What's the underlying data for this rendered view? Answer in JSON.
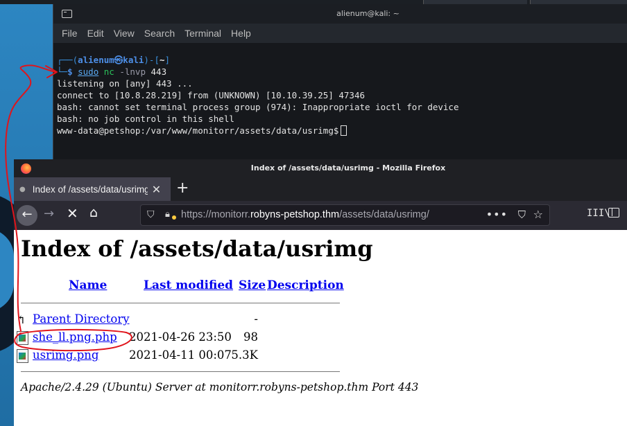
{
  "terminal": {
    "title": "alienum@kali: ~",
    "menu": [
      "File",
      "Edit",
      "View",
      "Search",
      "Terminal",
      "Help"
    ],
    "prompt": {
      "open": "┌──(",
      "user_host": "alienum㉿kali",
      "dir_open": ")-[",
      "dir": "~",
      "dir_close": "]",
      "prefix": "└─",
      "dollar": "$",
      "cmd": "sudo",
      "prog": "nc",
      "args": "-lnvp",
      "port": "443"
    },
    "output": [
      "listening on [any] 443 ...",
      "connect to [10.8.28.219] from (UNKNOWN) [10.10.39.25] 47346",
      "bash: cannot set terminal process group (974): Inappropriate ioctl for device",
      "bash: no job control in this shell"
    ],
    "shell_prompt": "www-data@petshop:/var/www/monitorr/assets/data/usrimg$"
  },
  "firefox": {
    "window_title": "Index of /assets/data/usrimg - Mozilla Firefox",
    "tab_label": "Index of /assets/data/usrimg",
    "url_prefix": "https://monitorr.",
    "url_host": "robyns-petshop.thm",
    "url_path": "/assets/data/usrimg/",
    "icons": {
      "back": "arrow-left-icon",
      "forward": "arrow-right-icon",
      "stop": "close-icon",
      "home": "home-icon",
      "shield": "shield-icon",
      "lock": "lock-warning-icon",
      "more": "more-icon",
      "pocket": "pocket-icon",
      "bookmark": "star-icon",
      "library": "library-icon",
      "sidebar": "sidebar-icon"
    }
  },
  "page": {
    "heading": "Index of /assets/data/usrimg",
    "columns": {
      "name": "Name",
      "last_modified": "Last modified",
      "size": "Size",
      "description": "Description"
    },
    "rows": [
      {
        "name": "Parent Directory",
        "date": "",
        "size": "-"
      },
      {
        "name": "she_ll.png.php",
        "date": "2021-04-26 23:50",
        "size": "98"
      },
      {
        "name": "usrimg.png",
        "date": "2021-04-11 00:07",
        "size": "5.3K"
      }
    ],
    "address": "Apache/2.4.29 (Ubuntu) Server at monitorr.robyns-petshop.thm Port 443"
  },
  "colors": {
    "annotation": "#e0141b",
    "link": "#0000ee"
  }
}
